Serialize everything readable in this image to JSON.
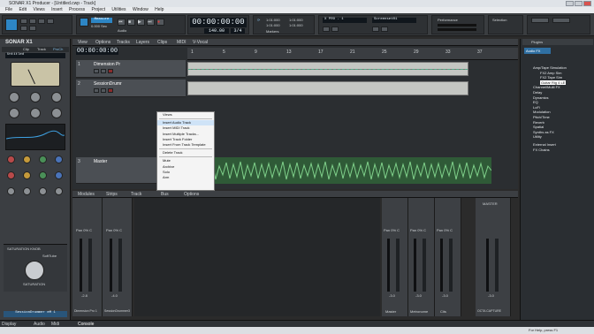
{
  "window": {
    "title": "SONAR X1 Producer - [Untitled.cwp - Track]"
  },
  "menu": [
    "File",
    "Edit",
    "Views",
    "Insert",
    "Process",
    "Project",
    "Utilities",
    "Window",
    "Help"
  ],
  "transport": {
    "mode": "Measure",
    "sub": "0.000 Sec",
    "time": "00:00:00:00",
    "tempo": "140.00",
    "meter": "3/4",
    "record_label": "Audio",
    "loop_start": "1:01:000",
    "loop_end": "1:01:000",
    "punch_start": "1:01:000",
    "punch_end": "1:01:000",
    "markers": "Markers",
    "preset": "X PRO - 1",
    "screenset": "Screenset01",
    "performance": "Performance",
    "selection": "Selection"
  },
  "inspector": {
    "app": "SONAR X1",
    "tabs": [
      "Clip",
      "Track",
      "ProCh"
    ],
    "preset": "Untitled",
    "sat": "SATURATION KNOB",
    "vendor": "SoftTube",
    "sat_knob": "SATURATION",
    "track": "SessionDrummer eM 1"
  },
  "trackview": {
    "menus": [
      "View",
      "Options",
      "Tracks",
      "Layers",
      "Clips",
      "MIDI",
      "V-Vocal"
    ],
    "now": "00:00:00:00",
    "ruler": [
      "1",
      "5",
      "9",
      "13",
      "17",
      "21",
      "25",
      "29",
      "33",
      "37"
    ],
    "tracks": [
      {
        "num": "1",
        "name": "Dimension Pr",
        "color": "#3a6b86"
      },
      {
        "num": "2",
        "name": "SessionDrumr",
        "color": "#3a6b86"
      },
      {
        "num": "3",
        "name": "Master",
        "color": "#3a6b86"
      }
    ]
  },
  "context": {
    "items": [
      "Views",
      "Insert Audio Track",
      "Insert MIDI Track",
      "Insert Multiple Tracks...",
      "Insert Track Folder",
      "Insert From Track Template",
      "Delete Track",
      "Mute",
      "Archive",
      "Solo",
      "Arm"
    ]
  },
  "console": {
    "menus": [
      "Modules",
      "Strips",
      "Track",
      "Bus",
      "Options"
    ],
    "strips": [
      {
        "name": "Dimension Pro 1",
        "num": "1",
        "vol": "-2.8",
        "pan": "Pan  0% C"
      },
      {
        "name": "SessionDrummer3",
        "num": "2",
        "vol": "-4.0",
        "pan": "Pan  0% C"
      },
      {
        "name": "Master",
        "num": "A",
        "vol": "-3.0",
        "pan": "Pan  0% C"
      },
      {
        "name": "Metronome",
        "num": "B",
        "vol": "-3.0",
        "pan": "Pan  0% C"
      },
      {
        "name": "Cits",
        "num": "C",
        "vol": "-3.0",
        "pan": "Pan  0% C"
      },
      {
        "name": "OCTA CAPTURE",
        "num": "",
        "vol": "-3.0",
        "pan": "MASTER"
      }
    ]
  },
  "browser": {
    "tabs": [
      "Plugins",
      "Audio FX"
    ],
    "tree": [
      "Amp/Tape Simulation",
      "FX2 Amp Sim",
      "FX2 Tape Sim",
      "Guitar Rig 4 LE",
      "Channel/Multi FX",
      "Delay",
      "Dynamics",
      "EQ",
      "LoFi",
      "Modulation",
      "Pitch/Time",
      "Reverb",
      "Spatial",
      "Synths as FX",
      "Utility",
      "External Insert",
      "FX Chains"
    ]
  },
  "bottom_tabs": [
    "Console",
    "Display",
    "Audio",
    "Midi"
  ],
  "status": "For Help, press F1",
  "status_right": [
    "NUM"
  ]
}
